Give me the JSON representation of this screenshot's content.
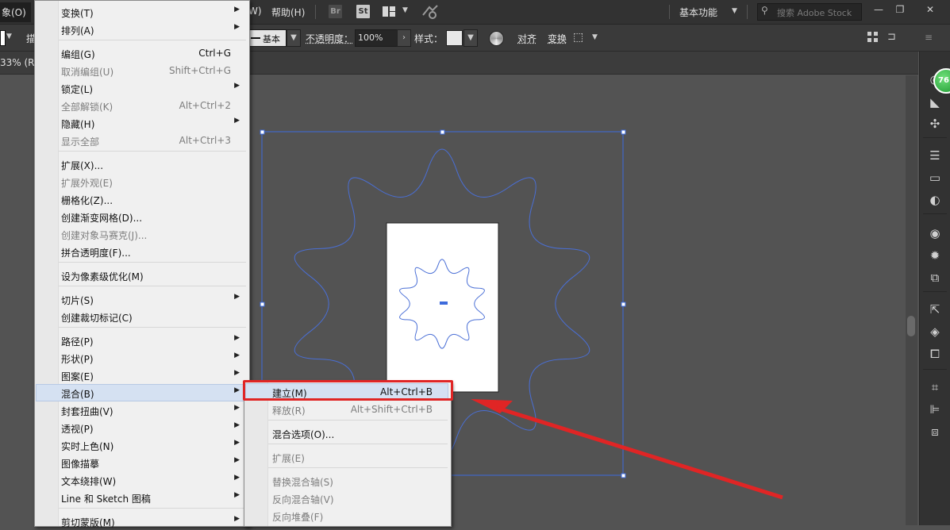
{
  "menubar": {
    "object_menu": "象(O)",
    "help_menu_partial": "W)",
    "help_menu": "帮助(H)",
    "bridge_tile": "Br",
    "stock_tile": "St",
    "workspace": "基本功能",
    "search_placeholder": "搜索 Adobe Stock"
  },
  "controlbar": {
    "stroke_style": "基本",
    "opacity_label": "不透明度：",
    "opacity_value": "100%",
    "style_label": "样式：",
    "align_label": "对齐",
    "transform_label": "变换",
    "partial_label": "描"
  },
  "document": {
    "tab_label": "33% (R"
  },
  "badge": {
    "value": "76"
  },
  "object_menu": {
    "items": [
      {
        "label": "变换(T)",
        "shortcut": "",
        "arrow": true,
        "disabled": false
      },
      {
        "label": "排列(A)",
        "shortcut": "",
        "arrow": true,
        "disabled": false
      },
      {
        "label": "编组(G)",
        "shortcut": "Ctrl+G",
        "arrow": false,
        "disabled": false
      },
      {
        "label": "取消编组(U)",
        "shortcut": "Shift+Ctrl+G",
        "arrow": false,
        "disabled": true
      },
      {
        "label": "锁定(L)",
        "shortcut": "",
        "arrow": true,
        "disabled": false
      },
      {
        "label": "全部解锁(K)",
        "shortcut": "Alt+Ctrl+2",
        "arrow": false,
        "disabled": true
      },
      {
        "label": "隐藏(H)",
        "shortcut": "",
        "arrow": true,
        "disabled": false
      },
      {
        "label": "显示全部",
        "shortcut": "Alt+Ctrl+3",
        "arrow": false,
        "disabled": true
      },
      {
        "label": "扩展(X)...",
        "shortcut": "",
        "arrow": false,
        "disabled": false
      },
      {
        "label": "扩展外观(E)",
        "shortcut": "",
        "arrow": false,
        "disabled": true
      },
      {
        "label": "栅格化(Z)...",
        "shortcut": "",
        "arrow": false,
        "disabled": false
      },
      {
        "label": "创建渐变网格(D)...",
        "shortcut": "",
        "arrow": false,
        "disabled": false
      },
      {
        "label": "创建对象马赛克(J)...",
        "shortcut": "",
        "arrow": false,
        "disabled": true
      },
      {
        "label": "拼合透明度(F)...",
        "shortcut": "",
        "arrow": false,
        "disabled": false
      },
      {
        "label": "设为像素级优化(M)",
        "shortcut": "",
        "arrow": false,
        "disabled": false
      },
      {
        "label": "切片(S)",
        "shortcut": "",
        "arrow": true,
        "disabled": false
      },
      {
        "label": "创建裁切标记(C)",
        "shortcut": "",
        "arrow": false,
        "disabled": false
      },
      {
        "label": "路径(P)",
        "shortcut": "",
        "arrow": true,
        "disabled": false
      },
      {
        "label": "形状(P)",
        "shortcut": "",
        "arrow": true,
        "disabled": false
      },
      {
        "label": "图案(E)",
        "shortcut": "",
        "arrow": true,
        "disabled": false
      },
      {
        "label": "混合(B)",
        "shortcut": "",
        "arrow": true,
        "disabled": false,
        "highlighted": true
      },
      {
        "label": "封套扭曲(V)",
        "shortcut": "",
        "arrow": true,
        "disabled": false
      },
      {
        "label": "透视(P)",
        "shortcut": "",
        "arrow": true,
        "disabled": false
      },
      {
        "label": "实时上色(N)",
        "shortcut": "",
        "arrow": true,
        "disabled": false
      },
      {
        "label": "图像描摹",
        "shortcut": "",
        "arrow": true,
        "disabled": false
      },
      {
        "label": "文本绕排(W)",
        "shortcut": "",
        "arrow": true,
        "disabled": false
      },
      {
        "label": "Line 和 Sketch 图稿",
        "shortcut": "",
        "arrow": true,
        "disabled": false
      },
      {
        "label": "剪切蒙版(M)",
        "shortcut": "",
        "arrow": true,
        "disabled": false
      }
    ]
  },
  "blend_submenu": {
    "items": [
      {
        "label": "建立(M)",
        "shortcut": "Alt+Ctrl+B",
        "disabled": false,
        "highlighted": true
      },
      {
        "label": "释放(R)",
        "shortcut": "Alt+Shift+Ctrl+B",
        "disabled": true
      },
      {
        "label": "混合选项(O)...",
        "shortcut": "",
        "disabled": false
      },
      {
        "label": "扩展(E)",
        "shortcut": "",
        "disabled": true
      },
      {
        "label": "替换混合轴(S)",
        "shortcut": "",
        "disabled": true
      },
      {
        "label": "反向混合轴(V)",
        "shortcut": "",
        "disabled": true
      },
      {
        "label": "反向堆叠(F)",
        "shortcut": "",
        "disabled": true
      }
    ]
  },
  "colors": {
    "highlight_box": "#e02525",
    "arrow": "#e02525",
    "star_path": "#4a6fd6",
    "selection": "#3e6bdc"
  }
}
